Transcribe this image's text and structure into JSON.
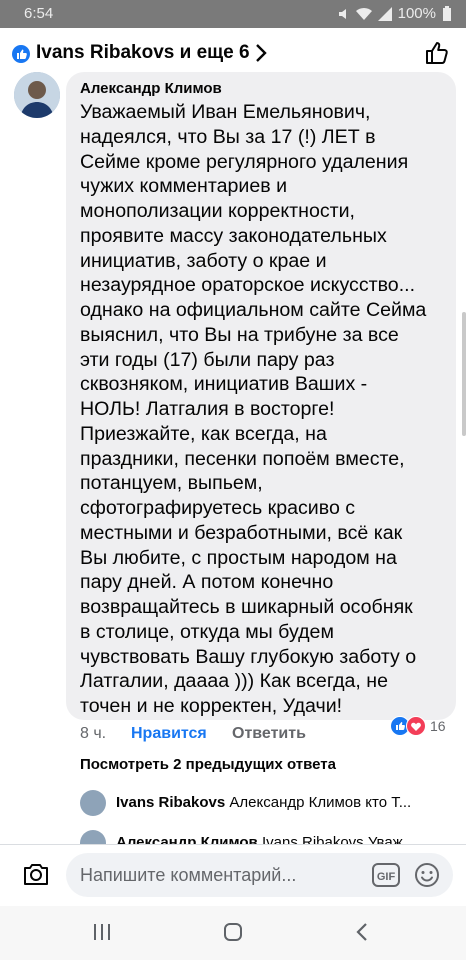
{
  "status_bar": {
    "time": "6:54",
    "battery": "100%"
  },
  "header": {
    "title": "Ivans Ribakovs и еще 6"
  },
  "comment": {
    "author": "Александр Климов",
    "text": "Уважаемый Иван Емельянович,\nнадеялся, что Вы за 17 (!) ЛЕТ в\nСейме кроме регулярного удаления\nчужих комментариев и\nмонополизации корректности,\nпроявите массу законодательных\nинициатив, заботу о крае и\nнезаурядное ораторское искусство...\nоднако на официальном сайте Сейма\nвыяснил, что Вы на трибуне за все\nэти годы (17) были пару раз\nсквозняком, инициатив Ваших -\nНОЛЬ! Латгалия в восторге!\nПриезжайте, как всегда, на\nпраздники, песенки попоём вместе,\nпотанцуем, выпьем,\nсфотографируетесь  красиво с\nместными и безработными, всё как\nВы любите, с простым народом на\nпару дней. А потом конечно\nвозвращайтесь в шикарный особняк\nв столице, откуда мы будем\nчувствовать Вашу глубокую заботу о\nЛатгалии, даааа ))) Как всегда, не\nточен и не корректен, Удачи!",
    "time": "8 ч.",
    "like_label": "Нравится",
    "reply_label": "Ответить",
    "reaction_count": "16"
  },
  "more_replies": "Посмотреть 2 предыдущих ответа",
  "replies": [
    {
      "author": "Ivans Ribakovs",
      "preview": "Александр Климов  кто Т..."
    },
    {
      "author": "Александр Климов",
      "preview": "Ivans Ribakovs Уваж..."
    }
  ],
  "composer": {
    "placeholder": "Напишите комментарий..."
  },
  "colors": {
    "accent": "#1877f2",
    "bubble": "#efeff1",
    "muted": "#65676b",
    "love": "#f33e58"
  }
}
